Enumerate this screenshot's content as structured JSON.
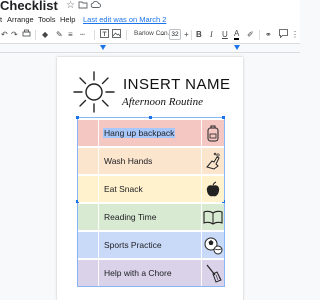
{
  "app": {
    "doc_title": "Checklist",
    "title_icons": [
      "star-icon",
      "folder-icon",
      "cloud-icon"
    ]
  },
  "menu": {
    "items": [
      "t",
      "Arrange",
      "Tools",
      "Help"
    ],
    "last_edit": "Last edit was on March 2"
  },
  "toolbar": {
    "font_name": "Barlow Con...",
    "font_size": "32",
    "minus": "−",
    "plus": "+",
    "bold": "B",
    "italic": "I",
    "underline": "U",
    "text_color": "A"
  },
  "document": {
    "title": "INSERT NAME",
    "subtitle": "Afternoon Routine",
    "rows": [
      {
        "label": "Hang up backpack",
        "color": "#f4c7c3",
        "icon": "backpack-icon",
        "selected": true
      },
      {
        "label": "Wash Hands",
        "color": "#fce5cd",
        "icon": "hand-washing-icon"
      },
      {
        "label": "Eat Snack",
        "color": "#fff2cc",
        "icon": "apple-icon"
      },
      {
        "label": "Reading Time",
        "color": "#d9ead3",
        "icon": "open-book-icon"
      },
      {
        "label": "Sports Practice",
        "color": "#c9daf8",
        "icon": "sports-balls-icon"
      },
      {
        "label": "Help with a Chore",
        "color": "#d9d2e9",
        "icon": "broom-icon"
      }
    ]
  }
}
